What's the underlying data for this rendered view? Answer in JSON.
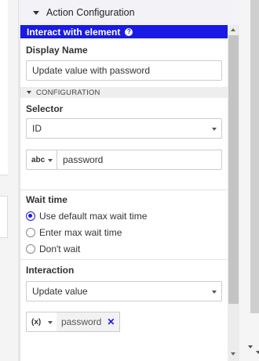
{
  "header": {
    "title": "Action Configuration"
  },
  "panel": {
    "title": "Interact with element"
  },
  "display_name": {
    "label": "Display Name",
    "value": "Update value with password"
  },
  "configuration": {
    "section_label": "CONFIGURATION"
  },
  "selector": {
    "label": "Selector",
    "value": "ID",
    "type": "abc",
    "input_value": "password"
  },
  "wait_time": {
    "label": "Wait time",
    "options": [
      "Use default max wait time",
      "Enter max wait time",
      "Don't wait"
    ],
    "selected_index": 0
  },
  "interaction": {
    "label": "Interaction",
    "value": "Update value",
    "var_type": "(x)",
    "var_value": "password"
  },
  "icons": {
    "help": "help-icon",
    "close": "close-icon",
    "caret": "caret-down-icon"
  },
  "colors": {
    "accent": "#1a1ae6"
  }
}
